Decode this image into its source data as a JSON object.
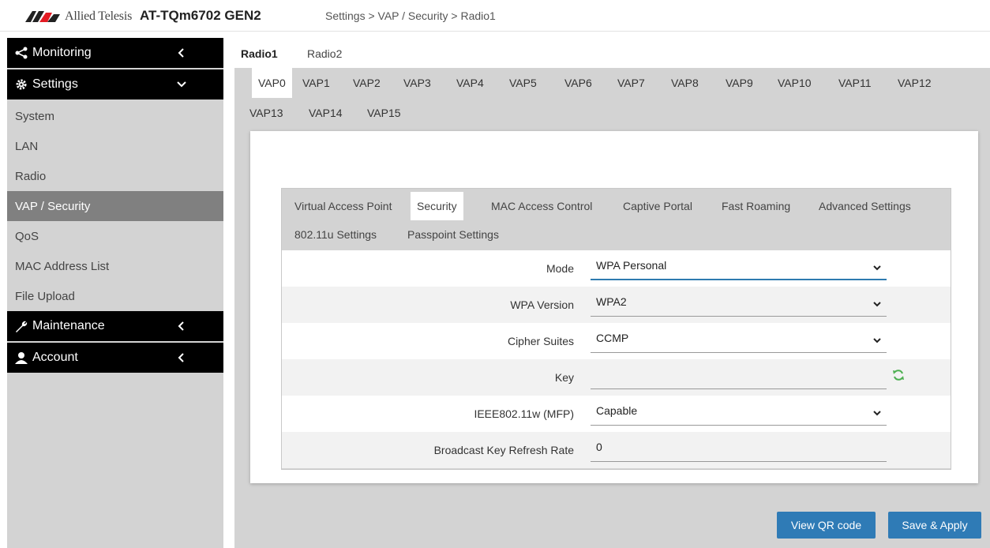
{
  "header": {
    "logo_text": "Allied Telesis",
    "model": "AT-TQm6702 GEN2",
    "breadcrumb": "Settings > VAP / Security > Radio1"
  },
  "sidebar": {
    "monitoring": "Monitoring",
    "settings": "Settings",
    "items": [
      "System",
      "LAN",
      "Radio",
      "VAP / Security",
      "QoS",
      "MAC Address List",
      "File Upload"
    ],
    "active_item": "VAP / Security",
    "maintenance": "Maintenance",
    "account": "Account"
  },
  "radio_tabs": [
    "Radio1",
    "Radio2"
  ],
  "vap_tabs": [
    "VAP0",
    "VAP1",
    "VAP2",
    "VAP3",
    "VAP4",
    "VAP5",
    "VAP6",
    "VAP7",
    "VAP8",
    "VAP9",
    "VAP10",
    "VAP11",
    "VAP12",
    "VAP13",
    "VAP14",
    "VAP15"
  ],
  "sub_tabs": [
    "Virtual Access Point",
    "Security",
    "MAC Access Control",
    "Captive Portal",
    "Fast Roaming",
    "Advanced Settings",
    "802.11u Settings",
    "Passpoint Settings"
  ],
  "form": {
    "mode": {
      "label": "Mode",
      "value": "WPA Personal"
    },
    "wpa_version": {
      "label": "WPA Version",
      "value": "WPA2"
    },
    "cipher": {
      "label": "Cipher Suites",
      "value": "CCMP"
    },
    "key": {
      "label": "Key",
      "value": ""
    },
    "mfp": {
      "label": "IEEE802.11w (MFP)",
      "value": "Capable"
    },
    "refresh": {
      "label": "Broadcast Key Refresh Rate",
      "value": "0"
    }
  },
  "buttons": {
    "qr": "View QR code",
    "save": "Save & Apply"
  },
  "colors": {
    "accent": "#2f7bb6",
    "sidebar_bg": "#d3d3d3",
    "active_item": "#808080",
    "refresh_icon": "#4caf50"
  }
}
